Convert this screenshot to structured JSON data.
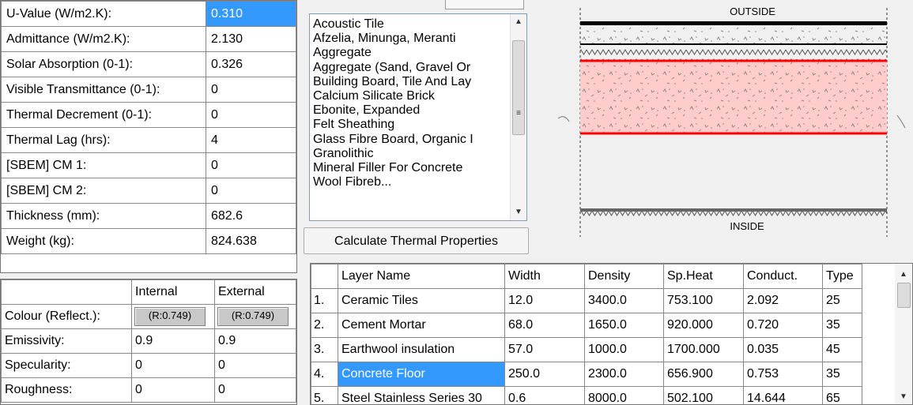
{
  "properties": [
    {
      "label": "U-Value (W/m2.K):",
      "value": "0.310",
      "selected": true
    },
    {
      "label": "Admittance (W/m2.K):",
      "value": "2.130"
    },
    {
      "label": "Solar Absorption (0-1):",
      "value": "0.326"
    },
    {
      "label": "Visible Transmittance (0-1):",
      "value": "0"
    },
    {
      "label": "Thermal Decrement (0-1):",
      "value": "0"
    },
    {
      "label": "Thermal Lag (hrs):",
      "value": "4"
    },
    {
      "label": "[SBEM] CM 1:",
      "value": "0"
    },
    {
      "label": "[SBEM] CM 2:",
      "value": "0"
    },
    {
      "label": "Thickness (mm):",
      "value": "682.6"
    },
    {
      "label": "Weight (kg):",
      "value": "824.638"
    }
  ],
  "surface": {
    "headers": [
      "",
      "Internal",
      "External"
    ],
    "rows": [
      {
        "label": "Colour (Reflect.):",
        "internal": "(R:0.749)",
        "external": "(R:0.749)",
        "button": true
      },
      {
        "label": "Emissivity:",
        "internal": "0.9",
        "external": "0.9"
      },
      {
        "label": "Specularity:",
        "internal": "0",
        "external": "0"
      },
      {
        "label": "Roughness:",
        "internal": "0",
        "external": "0"
      }
    ]
  },
  "materials": [
    "Acoustic Tile",
    "Afzelia, Minunga, Meranti",
    "Aggregate",
    "Aggregate (Sand, Gravel Or",
    "Building Board, Tile And Lay",
    "Calcium Silicate Brick",
    "Ebonite, Expanded",
    "Felt Sheathing",
    "Glass Fibre Board, Organic I",
    "Granolithic",
    "Mineral Filler For Concrete",
    "Wool Fibreb..."
  ],
  "calculate_button": "Calculate Thermal Properties",
  "section": {
    "outside_label": "OUTSIDE",
    "inside_label": "INSIDE",
    "highlight_color": "#ff0000",
    "fill_color": "#ffcccc"
  },
  "layers": {
    "headers": [
      "",
      "Layer Name",
      "Width",
      "Density",
      "Sp.Heat",
      "Conduct.",
      "Type"
    ],
    "rows": [
      {
        "num": "1.",
        "name": "Ceramic Tiles",
        "width": "12.0",
        "density": "3400.0",
        "spheat": "753.100",
        "conduct": "2.092",
        "type": "25"
      },
      {
        "num": "2.",
        "name": "Cement Mortar",
        "width": "68.0",
        "density": "1650.0",
        "spheat": "920.000",
        "conduct": "0.720",
        "type": "35"
      },
      {
        "num": "3.",
        "name": "Earthwool insulation",
        "width": "57.0",
        "density": "1000.0",
        "spheat": "1700.000",
        "conduct": "0.035",
        "type": "45"
      },
      {
        "num": "4.",
        "name": "Concrete Floor",
        "width": "250.0",
        "density": "2300.0",
        "spheat": "656.900",
        "conduct": "0.753",
        "type": "35",
        "selected": true
      },
      {
        "num": "5.",
        "name": "Steel Stainless Series 30",
        "width": "0.6",
        "density": "8000.0",
        "spheat": "502.100",
        "conduct": "14.644",
        "type": "65"
      }
    ]
  }
}
